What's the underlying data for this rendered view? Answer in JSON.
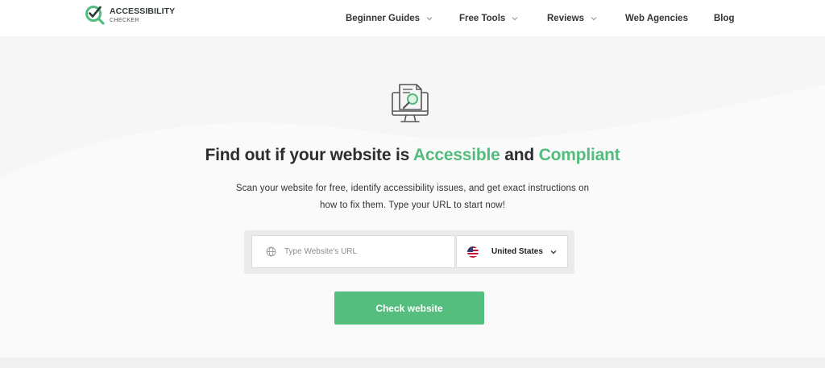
{
  "brand": {
    "title": "ACCESSIBILITY",
    "subtitle": "CHECKER",
    "accent_color": "#52bc7c"
  },
  "nav": {
    "items": [
      {
        "label": "Beginner Guides",
        "has_dropdown": true
      },
      {
        "label": "Free Tools",
        "has_dropdown": true
      },
      {
        "label": "Reviews",
        "has_dropdown": true
      },
      {
        "label": "Web Agencies",
        "has_dropdown": false
      },
      {
        "label": "Blog",
        "has_dropdown": false
      }
    ]
  },
  "hero": {
    "icon": "monitor-document-search-icon",
    "headline_prefix": "Find out if your website is ",
    "headline_accent_1": "Accessible",
    "headline_middle": " and ",
    "headline_accent_2": "Compliant",
    "subtext_line1": "Scan your website for free, identify accessibility issues, and get exact instructions on",
    "subtext_line2": "how to fix them. Type your URL to start now!"
  },
  "form": {
    "url_placeholder": "Type Website's URL",
    "url_value": "",
    "url_icon": "globe-icon",
    "country_selected": "United States",
    "country_flag": "us-flag-icon",
    "submit_label": "Check website",
    "button_color": "#55bd7d"
  }
}
